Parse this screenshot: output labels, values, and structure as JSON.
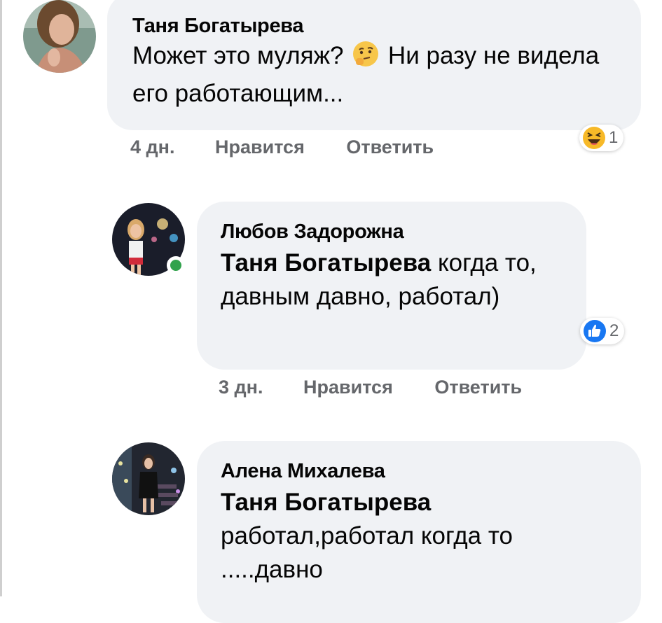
{
  "comments": [
    {
      "author": "Таня Богатырева",
      "text_before_emoji": "Может это муляж?",
      "inline_emoji": "thinking-face-emoji",
      "text_after_emoji": "Ни разу не видела его работающим...",
      "time": "4 дн.",
      "like_label": "Нравится",
      "reply_label": "Ответить",
      "reaction_icon": "haha-reaction-icon",
      "reaction_count": "1"
    },
    {
      "author": "Любов Задорожна",
      "mention": "Таня Богатырева",
      "text": " когда то, давным давно, работал)",
      "time": "3 дн.",
      "like_label": "Нравится",
      "reply_label": "Ответить",
      "reaction_icon": "like-reaction-icon",
      "reaction_count": "2",
      "online": true
    },
    {
      "author": "Алена Михалева",
      "mention": "Таня Богатырева",
      "text": "работал,работал когда то .....давно"
    }
  ],
  "colors": {
    "bubble": "#f0f2f5",
    "meta_text": "#65676b",
    "online": "#31a24c",
    "like_blue": "#1877f2",
    "haha_yellow": "#f7b928"
  }
}
